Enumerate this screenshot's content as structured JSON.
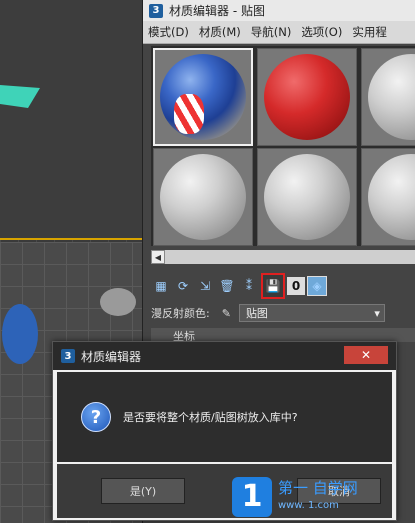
{
  "material_editor": {
    "app_badge": "3",
    "title": "材质编辑器 - 贴图",
    "menu": [
      "模式(D)",
      "材质(M)",
      "导航(N)",
      "选项(O)",
      "实用程"
    ],
    "diffuse_label": "漫反射颜色:",
    "map_select": "贴图",
    "rollout_label": "坐标",
    "toolbar_number": "0"
  },
  "dialog": {
    "app_badge": "3",
    "title": "材质编辑器",
    "close_glyph": "✕",
    "message": "是否要将整个材质/贴图树放入库中?",
    "yes_label": "是(Y)",
    "cancel_label": "取消"
  },
  "watermark": {
    "logo": "1",
    "text": "第一  自学网",
    "url": "www.  1.com"
  },
  "colors": {
    "highlight_border": "#e02020",
    "viewport_selection": "#d8a400"
  }
}
